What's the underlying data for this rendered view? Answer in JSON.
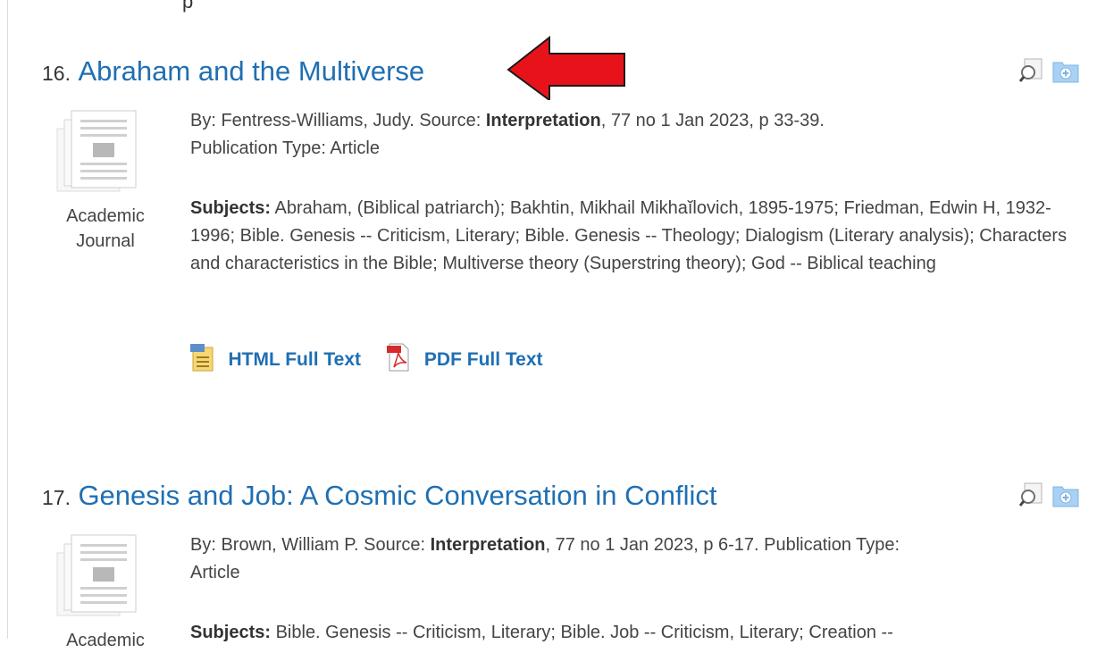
{
  "top_fragment": "p",
  "results": [
    {
      "number": "16.",
      "title": "Abraham and the Multiverse",
      "type_line1": "Academic",
      "type_line2": "Journal",
      "by_prefix": "By: Fentress-Williams, Judy. Source: ",
      "source": "Interpretation",
      "source_suffix": ", 77 no 1 Jan 2023, p 33-39.",
      "publication_type": "Publication Type: Article",
      "subjects_label": "Subjects:",
      "subjects": " Abraham, (Biblical patriarch); Bakhtin, Mikhail Mikhaĭlovich, 1895-1975; Friedman, Edwin H, 1932-1996; Bible. Genesis -- Criticism, Literary; Bible. Genesis -- Theology; Dialogism (Literary analysis); Characters and characteristics in the Bible; Multiverse theory (Superstring theory); God -- Biblical teaching",
      "html_link": "HTML Full Text",
      "pdf_link": "PDF Full Text"
    },
    {
      "number": "17.",
      "title": "Genesis and Job: A Cosmic Conversation in Conflict",
      "type_line1": "Academic",
      "by_prefix": "By: Brown, William P. Source: ",
      "source": "Interpretation",
      "source_suffix": ", 77 no 1 Jan 2023, p 6-17. Publication Type:",
      "publication_type": "Article",
      "subjects_label": "Subjects:",
      "subjects": " Bible. Genesis -- Criticism, Literary; Bible. Job -- Criticism, Literary; Creation --"
    }
  ],
  "icons": {
    "preview": "magnifier-icon",
    "add_folder": "folder-add-icon",
    "html_doc": "html-document-icon",
    "pdf_doc": "pdf-icon",
    "annotation": "red-arrow-annotation"
  },
  "colors": {
    "link": "#1f6fb3",
    "arrow": "#e8131a",
    "folder": "#a9d1f5"
  }
}
